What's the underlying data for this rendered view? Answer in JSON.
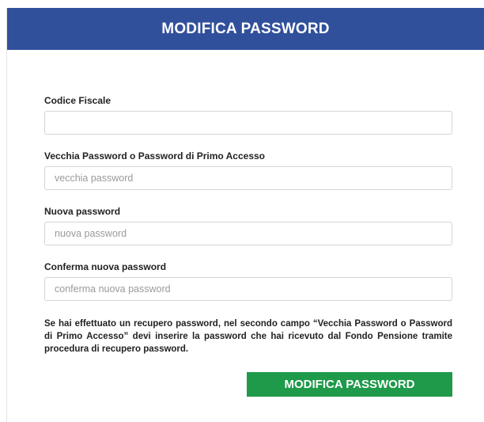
{
  "header": {
    "title": "MODIFICA PASSWORD"
  },
  "form": {
    "codice_fiscale": {
      "label": "Codice Fiscale",
      "value": "",
      "placeholder": ""
    },
    "vecchia_password": {
      "label": "Vecchia Password o Password di Primo Accesso",
      "value": "",
      "placeholder": "vecchia password"
    },
    "nuova_password": {
      "label": "Nuova password",
      "value": "",
      "placeholder": "nuova password"
    },
    "conferma_password": {
      "label": "Conferma nuova password",
      "value": "",
      "placeholder": "conferma nuova password"
    },
    "note": "Se hai effettuato un recupero password, nel secondo campo “Vecchia Password o Password di Primo Accesso” devi inserire la password che hai ricevuto dal Fondo Pensione tramite procedura di recupero password.",
    "submit_label": "MODIFICA PASSWORD"
  },
  "colors": {
    "header_bg": "#31509c",
    "submit_bg": "#1e9a4a"
  }
}
